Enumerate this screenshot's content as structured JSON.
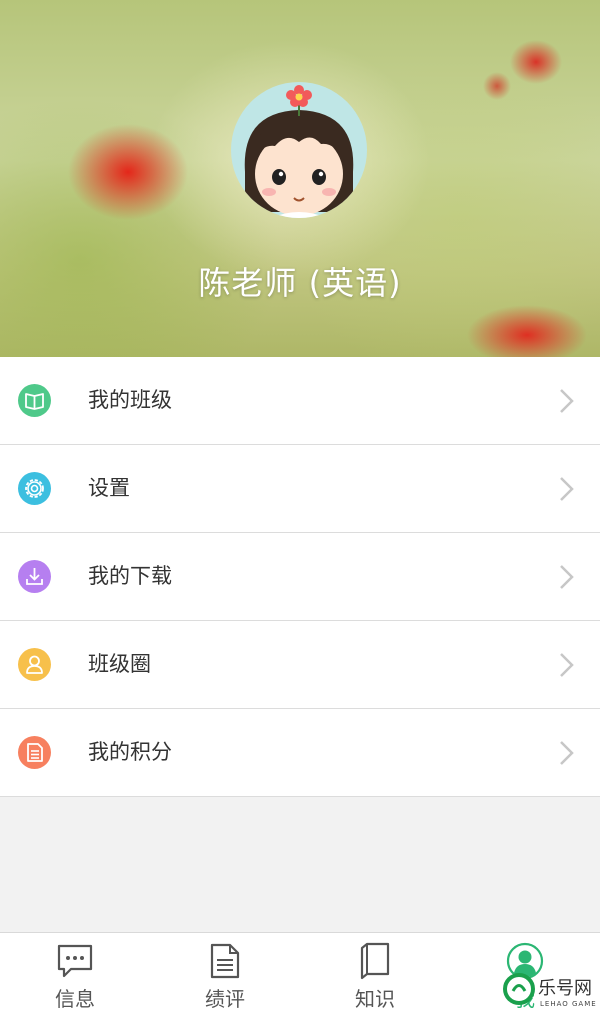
{
  "profile": {
    "name": "陈老师 (英语)"
  },
  "menu": {
    "items": [
      {
        "label": "我的班级",
        "icon": "book-icon",
        "color": "#4fc98a"
      },
      {
        "label": "设置",
        "icon": "gear-icon",
        "color": "#3cbfe0"
      },
      {
        "label": "我的下载",
        "icon": "download-icon",
        "color": "#b67ff0"
      },
      {
        "label": "班级圈",
        "icon": "person-icon",
        "color": "#f7c04b"
      },
      {
        "label": "我的积分",
        "icon": "document-icon",
        "color": "#f7805f"
      }
    ]
  },
  "tabbar": {
    "tabs": [
      {
        "label": "信息",
        "icon": "chat-bubble-icon"
      },
      {
        "label": "绩评",
        "icon": "document-icon"
      },
      {
        "label": "知识",
        "icon": "book-icon"
      },
      {
        "label": "我",
        "icon": "user-icon",
        "active": true
      }
    ]
  },
  "watermark": {
    "text": "乐号网",
    "sub": "LEHAO GAME"
  },
  "colors": {
    "active_tab": "#2bb673",
    "menu_text": "#333333",
    "chevron": "#c7c7c7"
  }
}
